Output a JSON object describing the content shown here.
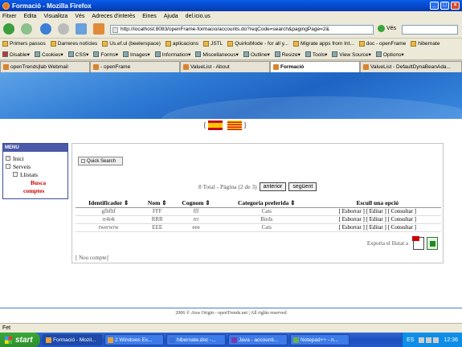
{
  "window": {
    "title": "Formació - Mozilla Firefox"
  },
  "menubar": [
    "Fitxer",
    "Edita",
    "Visualitza",
    "Vés",
    "Adreces d'interès",
    "Eines",
    "Ajuda",
    "del.icio.us"
  ],
  "navbar": {
    "url": "http://localhost:8083/openFrame-formacio/accounts.do?reqCode=search&pagingPage=2&",
    "go_label": "Vés"
  },
  "bookmarks": [
    "Primers passos",
    "Darreres notícies",
    "Us.ef.ul (beelerspace)",
    "aplicacions",
    "JSTL",
    "QuirksMode - for all y...",
    "Migrate apps from Int...",
    "doc - openFrame",
    "hibernate"
  ],
  "devbar": [
    "Disable▾",
    "Cookies▾",
    "CSS▾",
    "Forms▾",
    "Images▾",
    "Information▾",
    "Miscellaneous▾",
    "Outline▾",
    "Resize▾",
    "Tools▾",
    "View Source▾",
    "Options▾"
  ],
  "tabs": [
    {
      "label": "openTrends|lab Webmail",
      "active": false
    },
    {
      "label": "- openFrame",
      "active": false
    },
    {
      "label": "ValueList - About",
      "active": false
    },
    {
      "label": "Formació",
      "active": true
    },
    {
      "label": "ValueList - DefaultDynaBeanAda...",
      "active": false
    }
  ],
  "page": {
    "flag_left_bracket": "[",
    "flag_right_bracket": "]",
    "menu": {
      "header": "MENU",
      "inici": "Inici",
      "serveis": "Serveis",
      "llistats": "Llistats",
      "busca": "Busca",
      "comptes": "comptes"
    },
    "quick_search": "Quick Search",
    "pager": {
      "summary": "8 Total - Pàgina (2 de 3)",
      "prev": "anterior",
      "next": "següent"
    },
    "table": {
      "headers": [
        "Identificador",
        "Nom",
        "Cognom",
        "Categoria preferida",
        "Escull una opció"
      ],
      "rows": [
        [
          "gfhfhf",
          "FFF",
          "fff",
          "Cats",
          "[ Esborrar ] [ Editar ] [ Consultar ]"
        ],
        [
          "rr4t4t",
          "RRR",
          "rrr",
          "Birds",
          "[ Esborrar ] [ Editar ] [ Consultar ]"
        ],
        [
          "rwerwrw",
          "EEE",
          "eee",
          "Cats",
          "[ Esborrar ] [ Editar ] [ Consultar ]"
        ]
      ]
    },
    "export_label": "Exporta el llistat a",
    "new_account": "[ Nou compte]",
    "footer": "2006 © Atos Origin - openTrends.net   |   All rights reserved"
  },
  "status": "Fet",
  "taskbar": {
    "start": "start",
    "items": [
      "Formació - Mozil...",
      "2 Windows Ex...",
      "hibernate.doc -...",
      "Java - accounti...",
      "Notepad++ - n..."
    ],
    "lang": "ES",
    "clock": "12:36"
  }
}
